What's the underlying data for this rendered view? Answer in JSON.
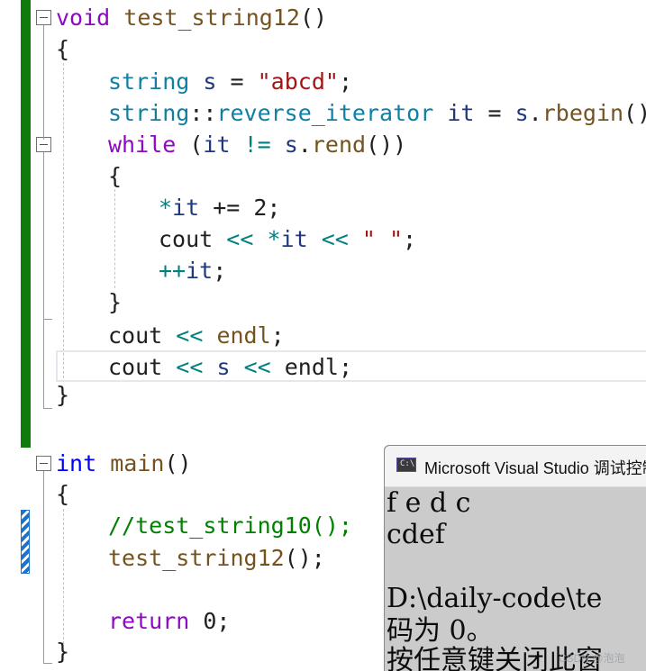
{
  "code": {
    "fn1": {
      "void_kw": "void",
      "name": "test_string12",
      "parens": "()",
      "open_brace": "{",
      "l1_type": "string",
      "l1_var": "s",
      "l1_eq": "=",
      "l1_str": "\"abcd\"",
      "l1_semi": ";",
      "l2_type": "string",
      "l2_scope": "::",
      "l2_itype": "reverse_iterator",
      "l2_var": "it",
      "l2_eq": "=",
      "l2_obj": "s",
      "l2_dot": ".",
      "l2_call": "rbegin",
      "l2_tail": "();",
      "while_kw": "while",
      "while_open": "(",
      "while_it": "it",
      "while_ne": "!=",
      "while_s": "s",
      "while_dot": ".",
      "while_rend": "rend",
      "while_close": "())",
      "inner_open": "{",
      "b1_star": "*",
      "b1_it": "it",
      "b1_rest": " += 2;",
      "b2_cout": "cout",
      "b2_op1": "<<",
      "b2_star": "*",
      "b2_it": "it",
      "b2_op2": "<<",
      "b2_str": "\" \"",
      "b2_semi": ";",
      "b3_inc": "++",
      "b3_it": "it",
      "b3_semi": ";",
      "inner_close": "}",
      "c1_cout": "cout",
      "c1_op": "<<",
      "c1_endl": "endl",
      "c1_semi": ";",
      "c2_cout": "cout",
      "c2_op1": "<<",
      "c2_s": "s",
      "c2_op2": "<<",
      "c2_endl": "endl",
      "c2_semi": ";",
      "close_brace": "}"
    },
    "fn2": {
      "int_kw": "int",
      "name": "main",
      "parens": "()",
      "open_brace": "{",
      "comment": "//test_string10();",
      "call_name": "test_string12",
      "call_tail": "();",
      "return_kw": "return",
      "return_val": "0;",
      "close_brace": "}"
    }
  },
  "console": {
    "icon_text": "C:\\",
    "title": "Microsoft Visual Studio 调试控制台",
    "lines": [
      "f e d c",
      "cdef",
      "",
      "D:\\daily-code\\te",
      "码为 0。",
      "按任意键关闭此窗"
    ]
  },
  "watermark": "CSDN @泡泡"
}
